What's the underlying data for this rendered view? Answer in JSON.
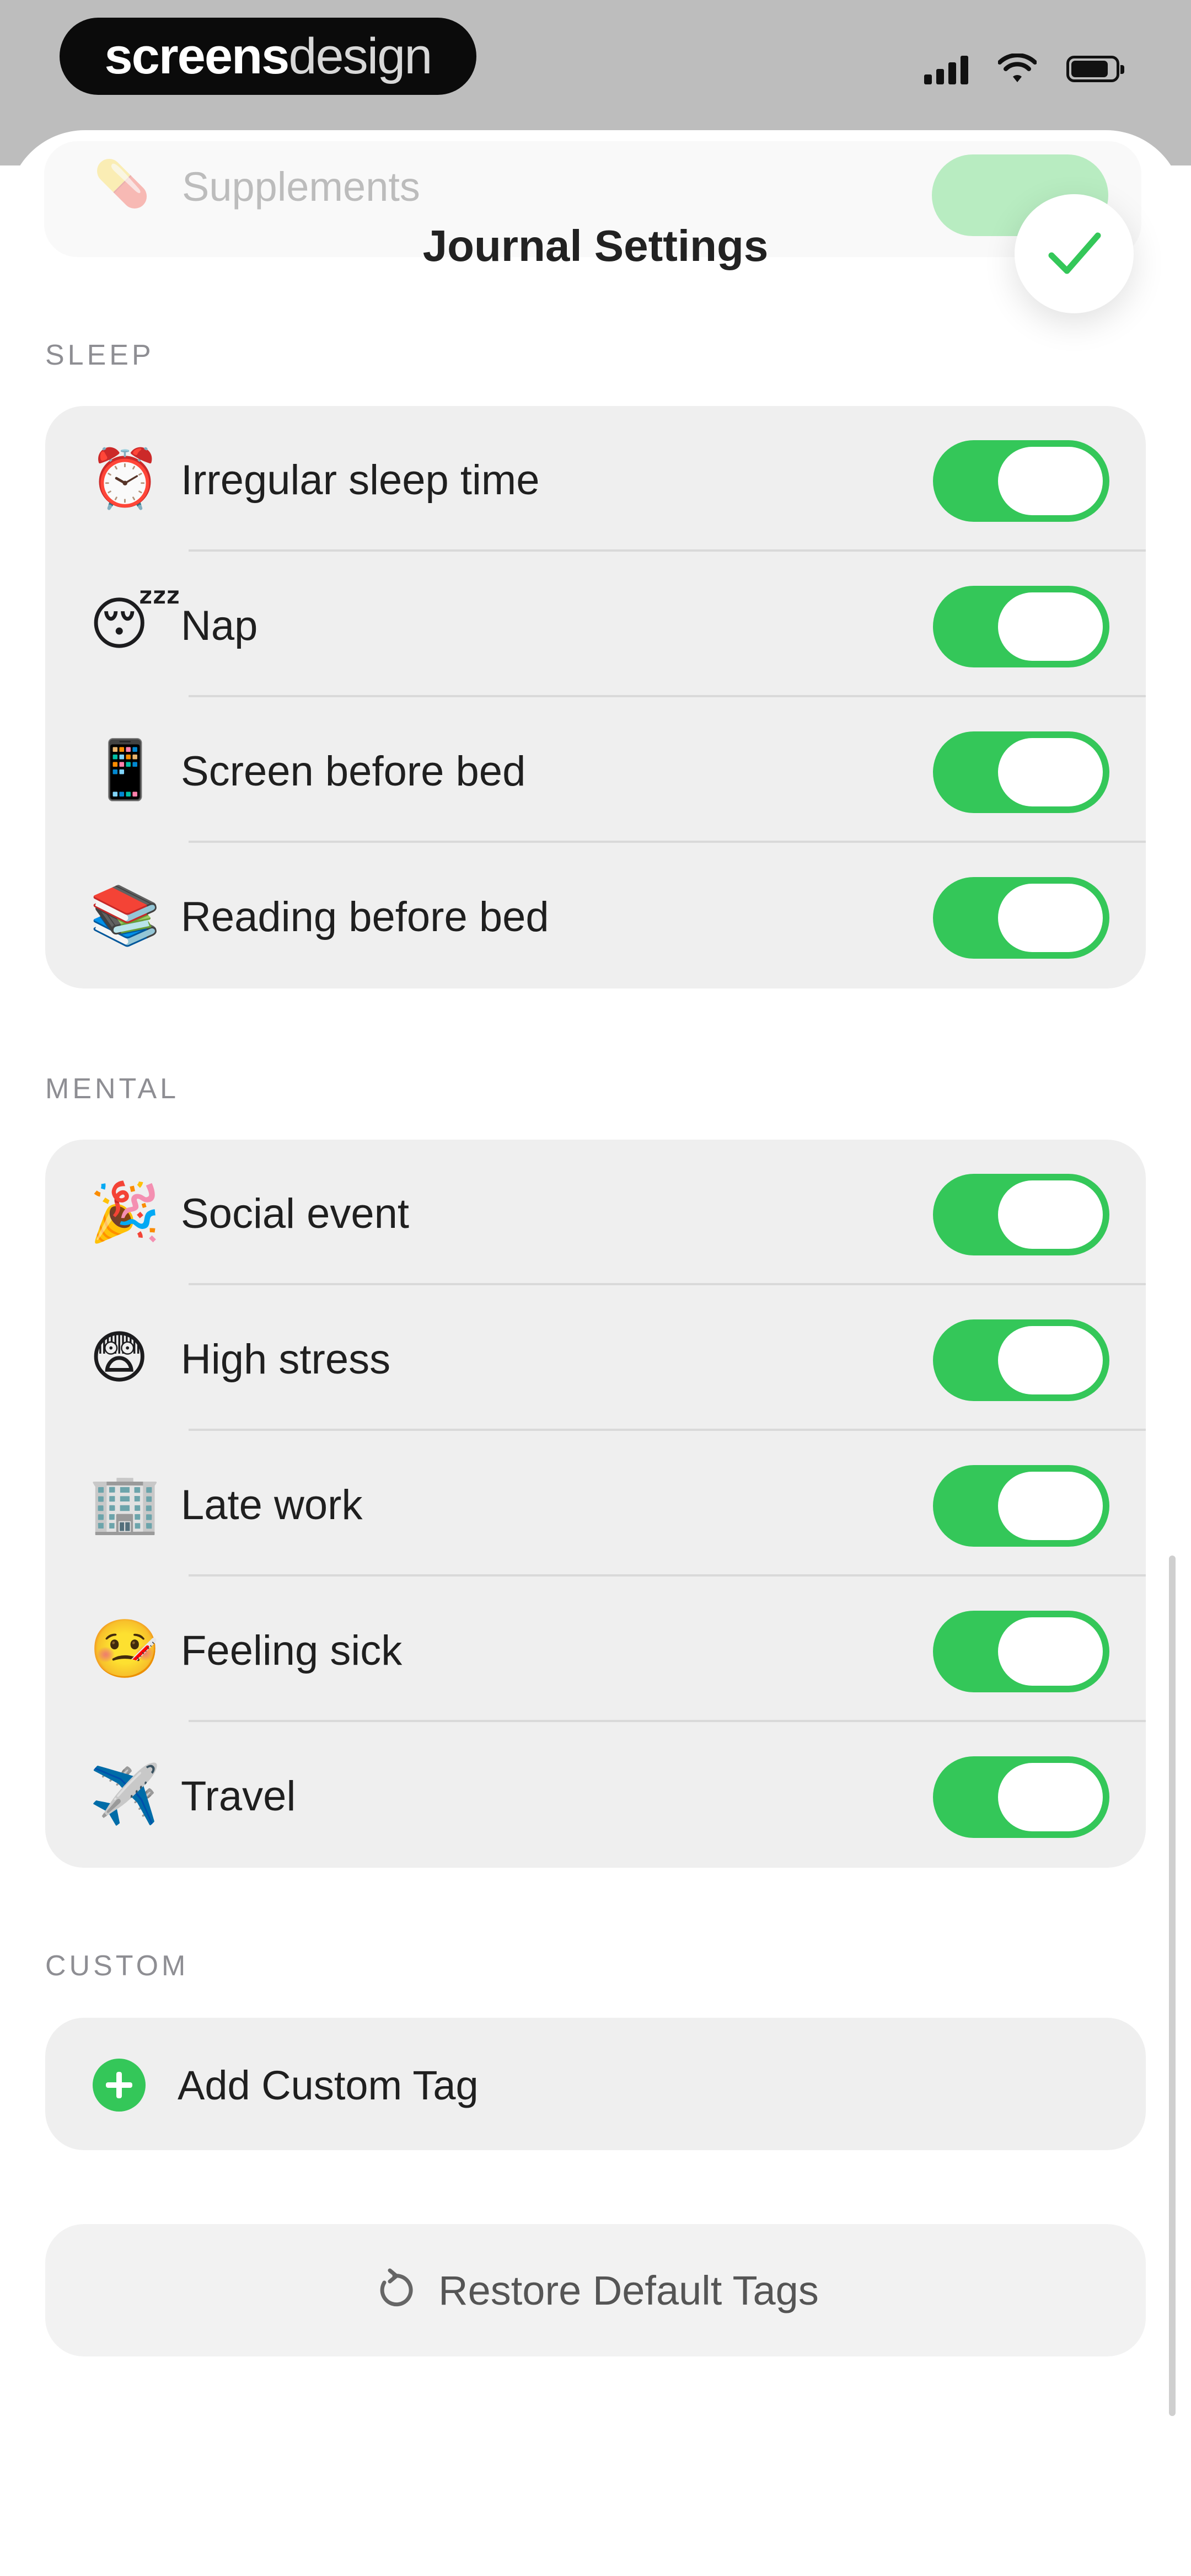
{
  "status_bar": {
    "brand_bold": "screens",
    "brand_light": "design"
  },
  "background_row": {
    "icon": "pill-emoji",
    "label": "Supplements",
    "enabled": true
  },
  "header": {
    "title": "Journal Settings",
    "done_icon": "checkmark-icon"
  },
  "sections": {
    "sleep": {
      "header": "SLEEP",
      "items": [
        {
          "emoji": "⏰",
          "label": "Irregular sleep time",
          "enabled": true
        },
        {
          "emoji": "😴",
          "label": "Nap",
          "enabled": true
        },
        {
          "emoji": "📱",
          "label": "Screen before bed",
          "enabled": true
        },
        {
          "emoji": "📚",
          "label": "Reading before bed",
          "enabled": true
        }
      ]
    },
    "mental": {
      "header": "MENTAL",
      "items": [
        {
          "emoji": "🎉",
          "label": "Social event",
          "enabled": true
        },
        {
          "emoji": "😨",
          "label": "High stress",
          "enabled": true
        },
        {
          "emoji": "🏢",
          "label": "Late work",
          "enabled": true
        },
        {
          "emoji": "🤒",
          "label": "Feeling sick",
          "enabled": true
        },
        {
          "emoji": "✈️",
          "label": "Travel",
          "enabled": true
        }
      ]
    },
    "custom": {
      "header": "CUSTOM",
      "add_label": "Add Custom Tag"
    }
  },
  "footer": {
    "restore_label": "Restore Default Tags"
  },
  "colors": {
    "toggle_on": "#34c759",
    "group_bg": "#efefef",
    "section_header": "#8e8e93"
  }
}
